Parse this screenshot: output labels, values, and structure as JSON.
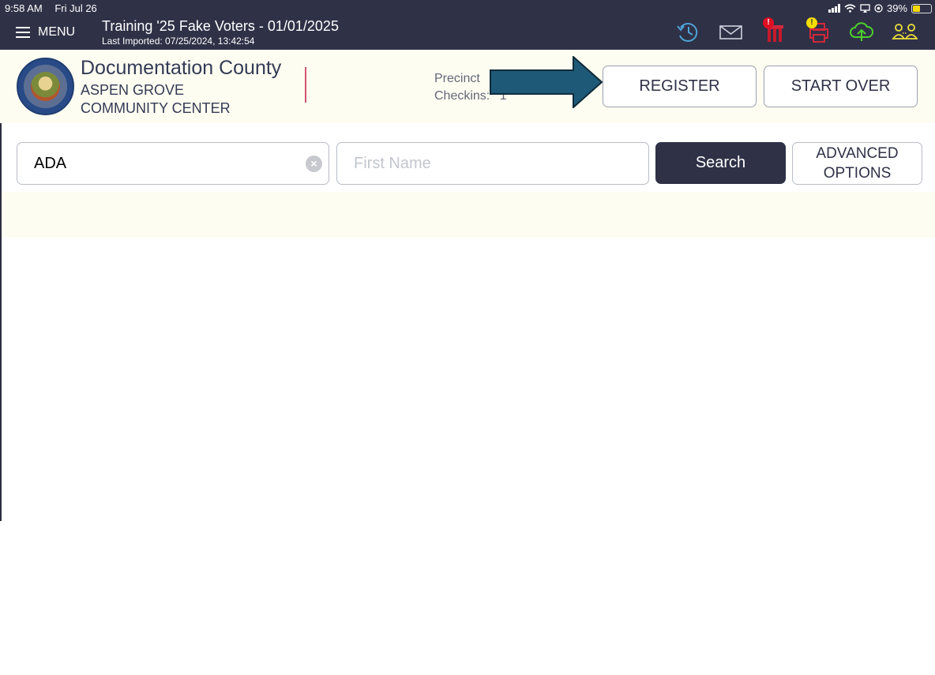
{
  "status_bar": {
    "time": "9:58 AM",
    "date": "Fri Jul 26",
    "battery": "39%",
    "battery_level": 0.39
  },
  "topbar": {
    "menu_label": "MENU",
    "title": "Training '25 Fake Voters - 01/01/2025",
    "subtitle": "Last Imported: 07/25/2024, 13:42:54",
    "icons": [
      "history-icon",
      "mail-icon",
      "ballot-alert-icon",
      "printer-alert-icon",
      "cloud-upload-icon",
      "users-icon"
    ],
    "alert_red": "!",
    "alert_yellow": "!"
  },
  "header": {
    "county": "Documentation County",
    "site_line1": "ASPEN GROVE",
    "site_line2": "COMMUNITY CENTER",
    "precinct_label": "Precinct",
    "checkins_label": "Checkins:",
    "checkins_value": "1",
    "register_label": "REGISTER",
    "start_over_label": "START OVER"
  },
  "search": {
    "last_name_value": "ADA",
    "first_name_placeholder": "First Name",
    "search_label": "Search",
    "advanced_line1": "ADVANCED",
    "advanced_line2": "OPTIONS"
  },
  "colors": {
    "topbar_bg": "#2f3147",
    "header_bg": "#fefdf1",
    "arrow": "#1e5a78",
    "divider": "#d4546e"
  }
}
